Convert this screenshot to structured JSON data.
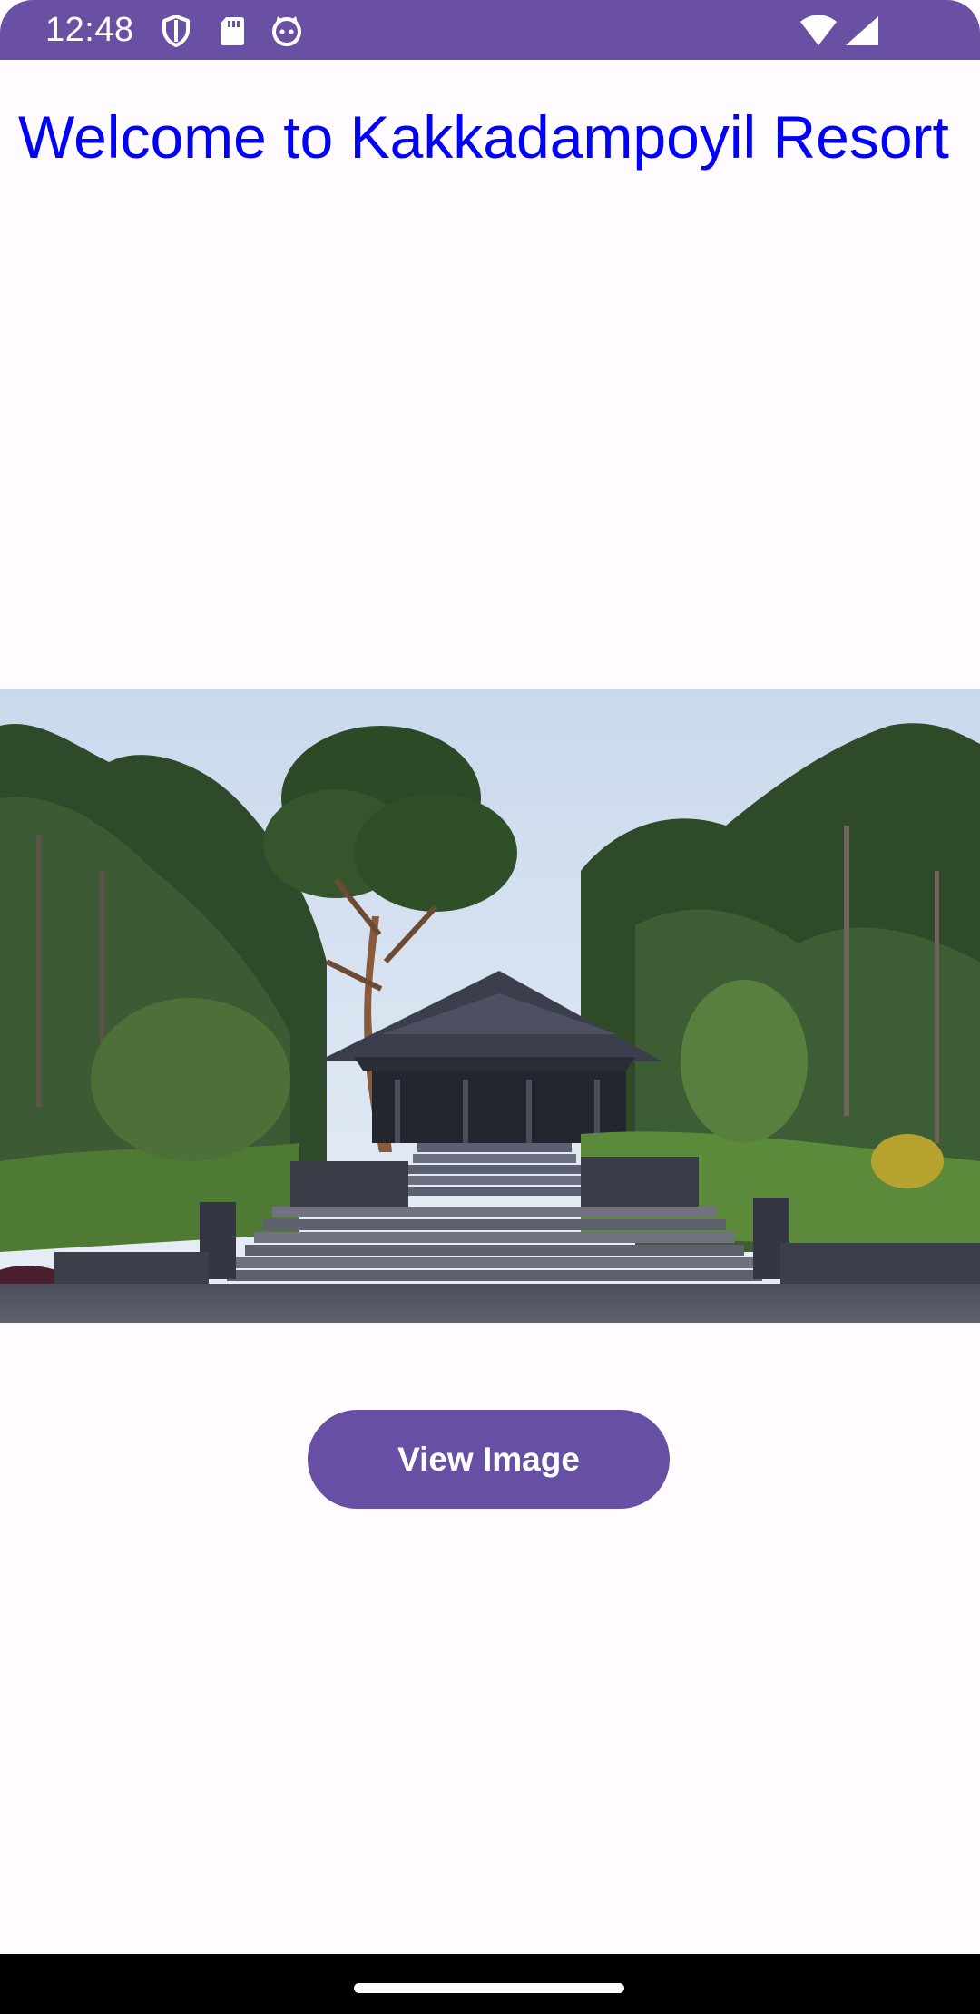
{
  "status_bar": {
    "time": "12:48",
    "background_color": "#6a50a2",
    "left_icons": [
      "shield-icon",
      "sd-card-icon",
      "cat-face-icon"
    ],
    "right_icons": [
      "wifi-icon",
      "cell-signal-icon"
    ]
  },
  "main": {
    "title": "Welcome to Kakkadampoyil Resort",
    "title_color": "#0000ff",
    "photo": "resort-building-with-stairs-and-trees",
    "button": {
      "label": "View Image",
      "color": "#6750a4"
    }
  },
  "nav_bar": {
    "home_indicator": "home-indicator"
  }
}
